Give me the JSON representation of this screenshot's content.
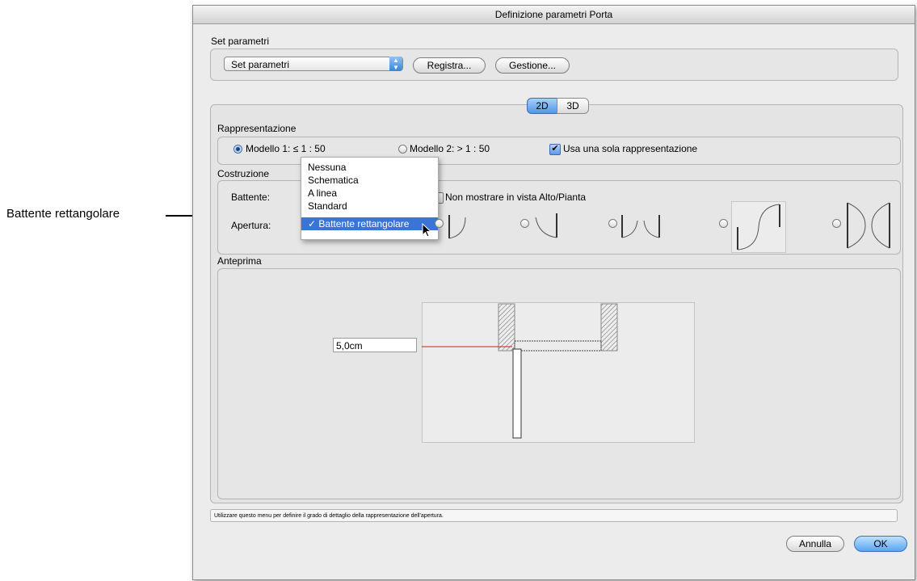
{
  "callout": {
    "label": "Battente rettangolare"
  },
  "window": {
    "title": "Definizione parametri Porta"
  },
  "set_parametri": {
    "group_label": "Set parametri",
    "popup_value": "Set parametri",
    "register_button": "Registra...",
    "manage_button": "Gestione..."
  },
  "tabs": [
    {
      "label": "2D",
      "selected": true
    },
    {
      "label": "3D",
      "selected": false
    }
  ],
  "rappresentazione": {
    "group_label": "Rappresentazione",
    "radio1": "Modello 1: ≤ 1 : 50",
    "radio2": "Modello 2: > 1 : 50",
    "checkbox": "Usa una sola rappresentazione",
    "check_mark": "✔"
  },
  "costruzione": {
    "group_label": "Costruzione",
    "battente_label": "Battente:",
    "apertura_label": "Apertura:",
    "hide_checkbox": "Non mostrare in vista Alto/Pianta"
  },
  "dropdown_menu": {
    "items": [
      "Nessuna",
      "Schematica",
      "A linea",
      "Standard",
      "✓ Battente rettangolare"
    ],
    "selected_index": 4
  },
  "anteprima": {
    "group_label": "Anteprima",
    "dimension_value": "5,0cm"
  },
  "status_bar": {
    "text": "Utilizzare questo menu per definire il grado di dettaglio della rappresentazione dell'apertura."
  },
  "footer": {
    "cancel_button": "Annulla",
    "ok_button": "OK"
  },
  "colors": {
    "accent": "#3a74d6",
    "dimension_line": "#d02020"
  }
}
